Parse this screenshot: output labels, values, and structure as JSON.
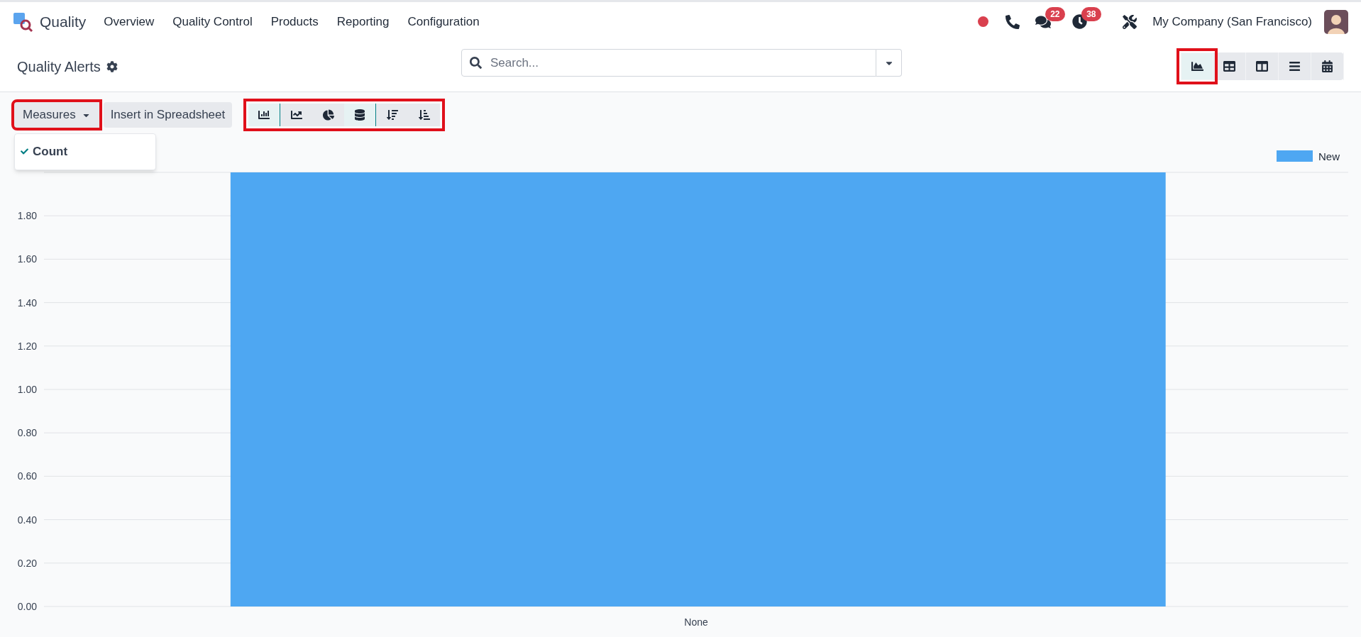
{
  "navbar": {
    "app_name": "Quality",
    "menu": [
      "Overview",
      "Quality Control",
      "Products",
      "Reporting",
      "Configuration"
    ],
    "message_count": "22",
    "activity_count": "38",
    "company": "My Company (San Francisco)"
  },
  "control_panel": {
    "title": "Quality Alerts",
    "search": {
      "placeholder": "Search..."
    },
    "views": [
      {
        "kind": "graph",
        "selected": true,
        "highlighted": true
      },
      {
        "kind": "pivot",
        "selected": false,
        "highlighted": false
      },
      {
        "kind": "kanban",
        "selected": false,
        "highlighted": false
      },
      {
        "kind": "list",
        "selected": false,
        "highlighted": false
      },
      {
        "kind": "calendar",
        "selected": false,
        "highlighted": false
      }
    ]
  },
  "toolbar": {
    "measures": {
      "label": "Measures",
      "highlighted": true,
      "options": [
        {
          "label": "Count",
          "checked": true
        }
      ]
    },
    "insert_button": "Insert in Spreadsheet",
    "chart_types_highlighted": true,
    "chart_types": [
      {
        "kind": "bar",
        "selected": true
      },
      {
        "kind": "line",
        "selected": false
      },
      {
        "kind": "pie",
        "selected": false
      },
      {
        "kind": "stacked",
        "selected": true
      },
      {
        "kind": "sort_descending",
        "selected": false
      },
      {
        "kind": "sort_ascending",
        "selected": false
      }
    ]
  },
  "chart": {
    "chart_data": {
      "type": "bar",
      "grid": true,
      "categories": [
        "None"
      ],
      "series": [
        {
          "name": "New",
          "color": "#4ea7f2",
          "values": [
            2
          ]
        }
      ],
      "ylim": [
        0,
        2
      ],
      "yticks": [
        {
          "value": 0,
          "label": "0.00"
        },
        {
          "value": 0.2,
          "label": "0.20"
        },
        {
          "value": 0.4,
          "label": "0.40"
        },
        {
          "value": 0.6,
          "label": "0.60"
        },
        {
          "value": 0.8,
          "label": "0.80"
        },
        {
          "value": 1,
          "label": "1.00"
        },
        {
          "value": 1.2,
          "label": "1.20"
        },
        {
          "value": 1.4,
          "label": "1.40"
        },
        {
          "value": 1.6,
          "label": "1.60"
        },
        {
          "value": 1.8,
          "label": "1.80"
        }
      ]
    }
  }
}
